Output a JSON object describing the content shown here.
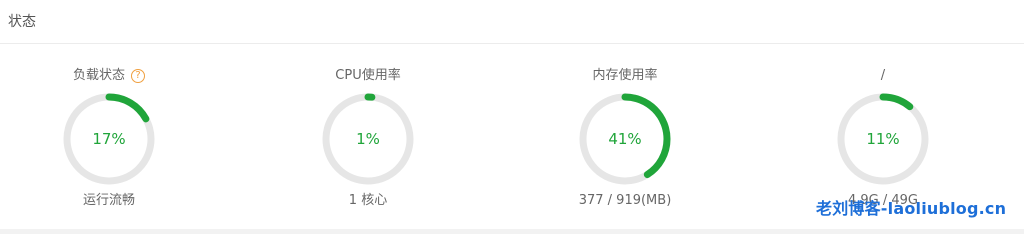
{
  "panel": {
    "title": "状态"
  },
  "gauges": [
    {
      "title": "负载状态",
      "has_help": true,
      "help_glyph": "?",
      "percent": 17,
      "value_text": "17%",
      "subtitle": "运行流畅"
    },
    {
      "title": "CPU使用率",
      "has_help": false,
      "percent": 1,
      "value_text": "1%",
      "subtitle": "1 核心"
    },
    {
      "title": "内存使用率",
      "has_help": false,
      "percent": 41,
      "value_text": "41%",
      "subtitle": "377 / 919(MB)"
    },
    {
      "title": "/",
      "has_help": false,
      "percent": 11,
      "value_text": "11%",
      "subtitle": "4.9G / 49G"
    }
  ],
  "watermark": "老刘博客-laoliublog.cn",
  "colors": {
    "accent": "#20a53a",
    "track": "#e6e6e6",
    "help": "#f0a040",
    "watermark": "#1e6fd8"
  },
  "icons": {
    "help": "help-circle-icon"
  }
}
